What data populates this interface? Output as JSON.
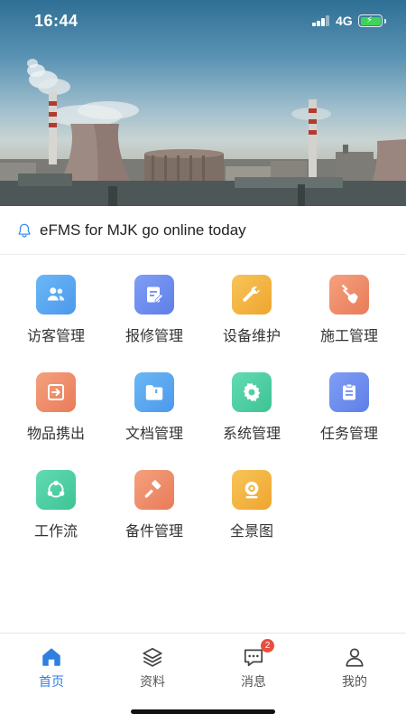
{
  "status": {
    "time": "16:44",
    "network": "4G"
  },
  "notice": {
    "text": "eFMS for MJK go online today"
  },
  "colors": {
    "accent": "#2f7fe0",
    "badge": "#e84d3d"
  },
  "modules": [
    {
      "label": "访客管理",
      "icon": "visitors-icon",
      "color": "#5aaaf0"
    },
    {
      "label": "报修管理",
      "icon": "repair-form-icon",
      "color": "#6f8ef0"
    },
    {
      "label": "设备维护",
      "icon": "wrench-icon",
      "color": "#f3b543"
    },
    {
      "label": "施工管理",
      "icon": "shovel-icon",
      "color": "#ef8f6c"
    },
    {
      "label": "物品携出",
      "icon": "export-icon",
      "color": "#ef8f6c"
    },
    {
      "label": "文档管理",
      "icon": "folder-icon",
      "color": "#5aaaf0"
    },
    {
      "label": "系统管理",
      "icon": "gear-icon",
      "color": "#4fd0a6"
    },
    {
      "label": "任务管理",
      "icon": "clipboard-icon",
      "color": "#6f8ef0"
    },
    {
      "label": "工作流",
      "icon": "workflow-icon",
      "color": "#4fd0a6"
    },
    {
      "label": "备件管理",
      "icon": "hammer-icon",
      "color": "#ef8f6c"
    },
    {
      "label": "全景图",
      "icon": "panorama-camera-icon",
      "color": "#f3b543"
    }
  ],
  "tabs": [
    {
      "label": "首页",
      "icon": "home-icon",
      "active": true
    },
    {
      "label": "资料",
      "icon": "layers-icon",
      "active": false
    },
    {
      "label": "消息",
      "icon": "message-icon",
      "active": false,
      "badge": "2"
    },
    {
      "label": "我的",
      "icon": "user-icon",
      "active": false
    }
  ]
}
